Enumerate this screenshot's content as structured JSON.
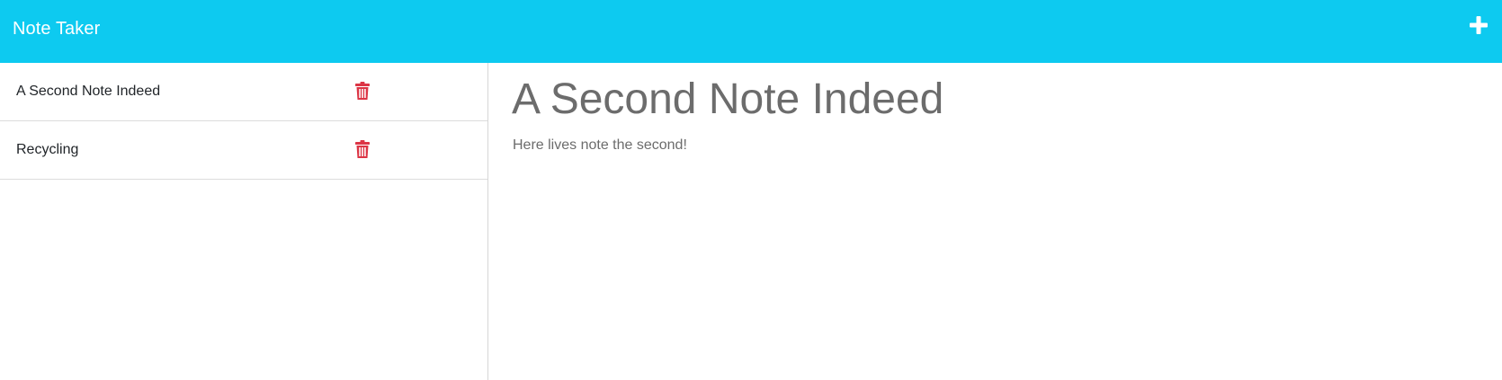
{
  "header": {
    "brand": "Note Taker",
    "new_note_icon": "plus-icon"
  },
  "colors": {
    "navbar": "#0dcaf0",
    "delete_icon": "#dc3545",
    "note_text": "#6c6c6c"
  },
  "sidebar": {
    "notes": [
      {
        "title": "A Second Note Indeed",
        "icon": "trash-icon"
      },
      {
        "title": "Recycling",
        "icon": "trash-icon"
      }
    ]
  },
  "editor": {
    "title": "A Second Note Indeed",
    "body": "Here lives note the second!"
  }
}
